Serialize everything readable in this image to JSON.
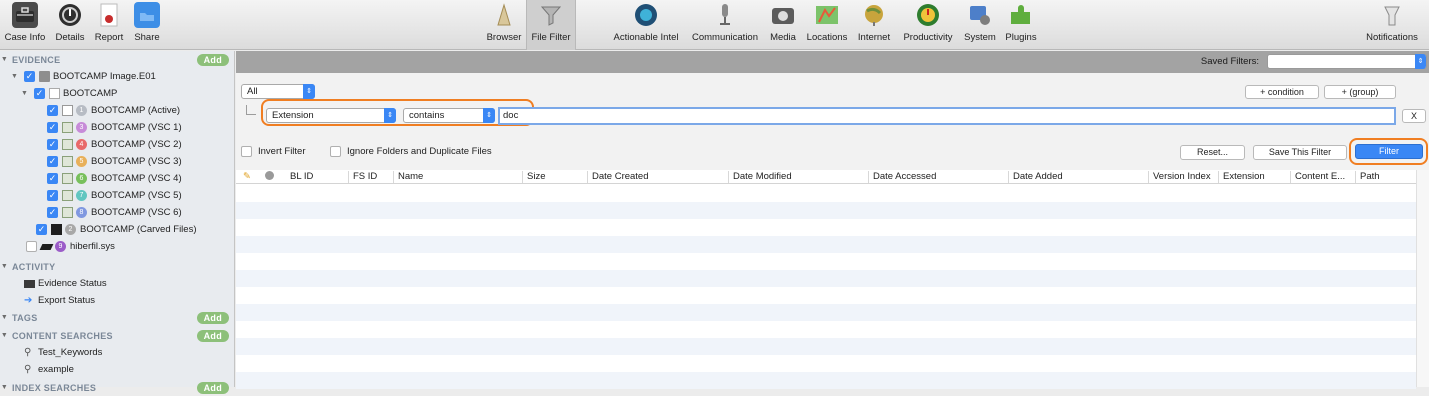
{
  "toolbar": {
    "left": [
      {
        "label": "Case Info",
        "icon": "briefcase-icon"
      },
      {
        "label": "Details",
        "icon": "details-icon"
      },
      {
        "label": "Report",
        "icon": "report-icon"
      },
      {
        "label": "Share",
        "icon": "share-icon"
      }
    ],
    "views": [
      {
        "label": "Browser",
        "icon": "browser-icon"
      },
      {
        "label": "File Filter",
        "icon": "file-filter-icon"
      }
    ],
    "categories": [
      {
        "label": "Actionable Intel",
        "icon": "actionable-intel-icon"
      },
      {
        "label": "Communication",
        "icon": "microphone-icon"
      },
      {
        "label": "Media",
        "icon": "media-icon"
      },
      {
        "label": "Locations",
        "icon": "map-icon"
      },
      {
        "label": "Internet",
        "icon": "globe-icon"
      },
      {
        "label": "Productivity",
        "icon": "productivity-icon"
      },
      {
        "label": "System",
        "icon": "system-icon"
      },
      {
        "label": "Plugins",
        "icon": "puzzle-icon"
      }
    ],
    "notifications": {
      "label": "Notifications",
      "icon": "notifications-icon"
    }
  },
  "sidebar": {
    "evidence_header": "EVIDENCE",
    "add_label": "Add",
    "image_name": "BOOTCAMP Image.E01",
    "volume_name": "BOOTCAMP",
    "snapshots": [
      {
        "badge": "1",
        "label": "BOOTCAMP (Active)",
        "color": "#b7bcc4"
      },
      {
        "badge": "3",
        "label": "BOOTCAMP (VSC 1)",
        "color": "#c78bd8"
      },
      {
        "badge": "4",
        "label": "BOOTCAMP (VSC 2)",
        "color": "#e86a6a"
      },
      {
        "badge": "5",
        "label": "BOOTCAMP (VSC 3)",
        "color": "#e8b05a"
      },
      {
        "badge": "6",
        "label": "BOOTCAMP (VSC 4)",
        "color": "#78c05c"
      },
      {
        "badge": "7",
        "label": "BOOTCAMP (VSC 5)",
        "color": "#62c6c0"
      },
      {
        "badge": "8",
        "label": "BOOTCAMP (VSC 6)",
        "color": "#8098e0"
      }
    ],
    "carved": {
      "badge": "2",
      "label": "BOOTCAMP (Carved Files)",
      "color": "#a8a8a8"
    },
    "hiberfil": {
      "badge": "9",
      "label": "hiberfil.sys",
      "color": "#9b5cc8"
    },
    "activity_header": "ACTIVITY",
    "activity_items": [
      "Evidence Status",
      "Export Status"
    ],
    "tags_header": "TAGS",
    "content_searches_header": "CONTENT SEARCHES",
    "content_searches": [
      "Test_Keywords",
      "example"
    ],
    "index_searches_header": "INDEX SEARCHES"
  },
  "filter": {
    "saved_filters_label": "Saved Filters:",
    "saved_filters_value": "",
    "match_mode": "All",
    "add_condition_label": "+ condition",
    "add_group_label": "+ (group)",
    "field": "Extension",
    "operator": "contains",
    "value": "doc",
    "remove_label": "X",
    "invert_label": "Invert Filter",
    "ignore_label": "Ignore Folders and Duplicate Files",
    "reset_label": "Reset...",
    "save_label": "Save This Filter",
    "apply_label": "Filter"
  },
  "table": {
    "columns": [
      "BL ID",
      "FS ID",
      "Name",
      "Size",
      "Date Created",
      "Date Modified",
      "Date Accessed",
      "Date Added",
      "Version Index",
      "Extension",
      "Content E...",
      "Path"
    ]
  }
}
